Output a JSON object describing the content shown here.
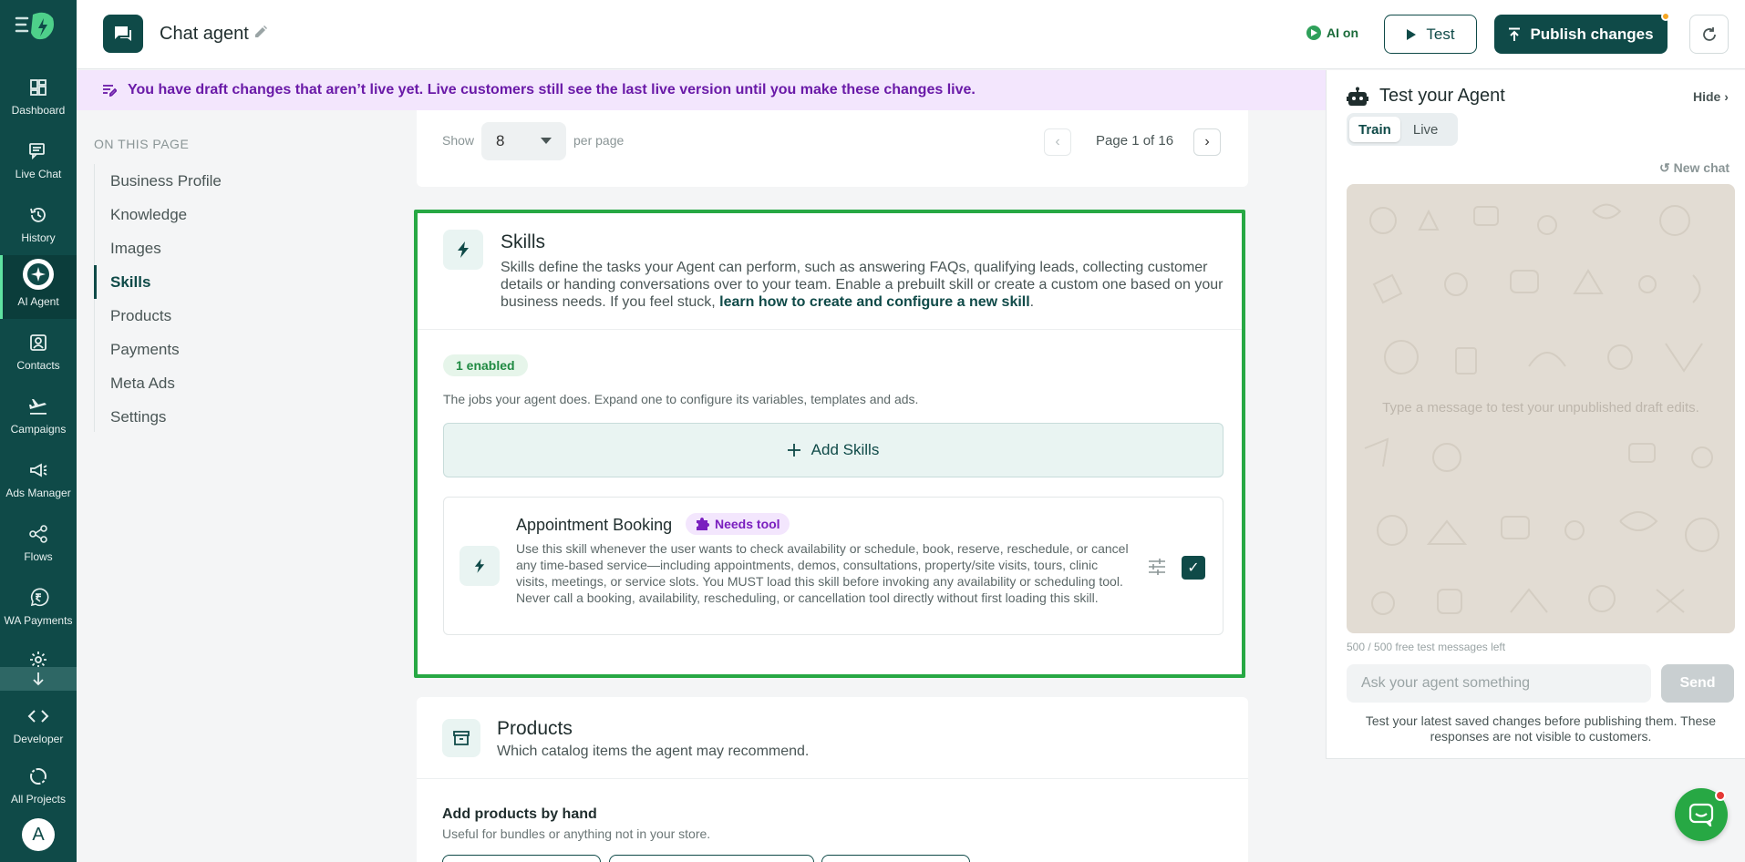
{
  "rail": {
    "items": [
      {
        "label": "Dashboard",
        "icon": "dashboard-icon"
      },
      {
        "label": "Live Chat",
        "icon": "chat-icon"
      },
      {
        "label": "History",
        "icon": "history-icon"
      },
      {
        "label": "AI Agent",
        "icon": "ai-sparkle-icon"
      },
      {
        "label": "Contacts",
        "icon": "contacts-icon"
      },
      {
        "label": "Campaigns",
        "icon": "plane-icon"
      },
      {
        "label": "Ads Manager",
        "icon": "megaphone-icon"
      },
      {
        "label": "Flows",
        "icon": "flows-icon"
      },
      {
        "label": "WA Payments",
        "icon": "rupee-icon"
      },
      {
        "label": "Developer",
        "icon": "code-icon"
      },
      {
        "label": "All Projects",
        "icon": "projects-icon"
      }
    ],
    "avatar_letter": "A"
  },
  "header": {
    "title": "Chat agent",
    "ai_status": "AI on",
    "test_label": "Test",
    "publish_label": "Publish changes"
  },
  "banner": {
    "text": "You have draft changes that aren’t live yet. Live customers still see the last live version until you make these changes live."
  },
  "on_this_page": {
    "label": "ON THIS PAGE",
    "items": [
      "Business Profile",
      "Knowledge",
      "Images",
      "Skills",
      "Products",
      "Payments",
      "Meta Ads",
      "Settings"
    ],
    "active": "Skills"
  },
  "pager": {
    "show_label": "Show",
    "per_page_value": "8",
    "per_page_label": "per page",
    "page_info": "Page 1 of 16"
  },
  "skills": {
    "title": "Skills",
    "desc_pre": "Skills define the tasks your Agent can perform, such as answering FAQs, qualifying leads, collecting customer details or handing conversations over to your team. Enable a prebuilt skill or create a custom one based on your business needs. If you feel stuck, ",
    "desc_link": "learn how to create and configure a new skill",
    "desc_post": ".",
    "enabled_badge": "1 enabled",
    "subtitle": "The jobs your agent does. Expand one to configure its variables, templates and ads.",
    "add_label": "Add Skills",
    "items": [
      {
        "name": "Appointment Booking",
        "badge": "Needs tool",
        "description": "Use this skill whenever the user wants to check availability or schedule, book, reserve, reschedule, or cancel any time-based service—including appointments, demos, consultations, property/site visits, tours, clinic visits, meetings, or service slots. You MUST load this skill before invoking any availability or scheduling tool. Never call a booking, availability, rescheduling, or cancellation tool directly without first loading this skill.",
        "enabled": true
      }
    ]
  },
  "products": {
    "title": "Products",
    "desc": "Which catalog items the agent may recommend.",
    "hand_title": "Add products by hand",
    "hand_desc": "Useful for bundles or anything not in your store."
  },
  "test_panel": {
    "title": "Test your Agent",
    "hide_label": "Hide ›",
    "tabs": [
      "Train",
      "Live"
    ],
    "active_tab": "Train",
    "new_chat_label": "↺ New chat",
    "placeholder_msg": "Type a message to test your unpublished draft edits.",
    "quota": "500 / 500 free test messages left",
    "input_placeholder": "Ask your agent something",
    "send_label": "Send",
    "note": "Test your latest saved changes before publishing them. These responses are not visible to customers."
  },
  "colors": {
    "brand": "#0f4a48",
    "accent_green": "#27a844",
    "banner_bg": "#f3e6fd",
    "banner_text": "#6a1aa8"
  }
}
